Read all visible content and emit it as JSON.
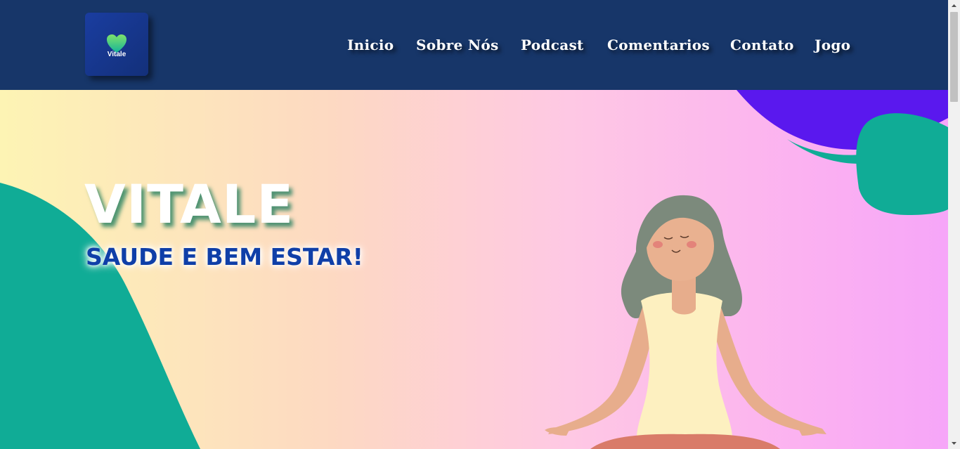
{
  "header": {
    "logo_text": "Vitale",
    "nav": [
      {
        "label": "Inicio"
      },
      {
        "label": "Sobre Nós"
      },
      {
        "label": "Podcast"
      },
      {
        "label": "Comentarios"
      },
      {
        "label": "Contato"
      },
      {
        "label": "Jogo"
      }
    ]
  },
  "hero": {
    "title": "VITALE",
    "subtitle": "SAUDE E BEM ESTAR!",
    "illustration": "meditating-woman-illustration"
  },
  "colors": {
    "header_bg": "#173669",
    "nav_text": "#ffffff",
    "title": "#ffffff",
    "subtitle": "#0f3fa8",
    "teal_shape": "#10ac96",
    "purple_shape": "#5a18ee"
  },
  "icons": [
    "heart-icon",
    "scroll-up-arrow-icon",
    "scroll-down-arrow-icon"
  ]
}
